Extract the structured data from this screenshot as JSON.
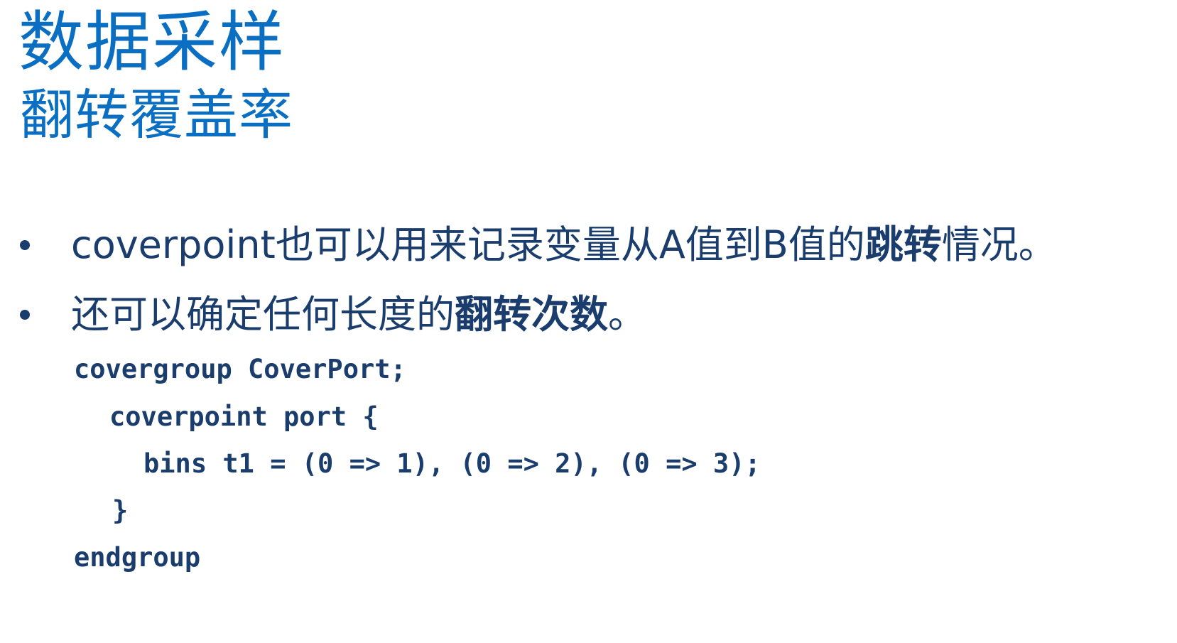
{
  "slide": {
    "title": "数据采样",
    "subtitle": "翻转覆盖率",
    "bullets": [
      {
        "parts": [
          {
            "text": "coverpoint也可以用来记录变量从A值到B值的",
            "bold": false
          },
          {
            "text": "跳转",
            "bold": true
          },
          {
            "text": "情况。",
            "bold": false
          }
        ]
      },
      {
        "parts": [
          {
            "text": "还可以确定任何长度的",
            "bold": false
          },
          {
            "text": "翻转次数",
            "bold": true
          },
          {
            "text": "。",
            "bold": false
          }
        ]
      }
    ],
    "code": [
      "covergroup CoverPort;",
      "coverpoint port {",
      "bins t1 = (0 => 1), (0 => 2), (0 => 3);",
      "}",
      "endgroup"
    ]
  },
  "colors": {
    "title": "#0a6fc2",
    "body": "#1a3d6d",
    "background": "#ffffff"
  }
}
